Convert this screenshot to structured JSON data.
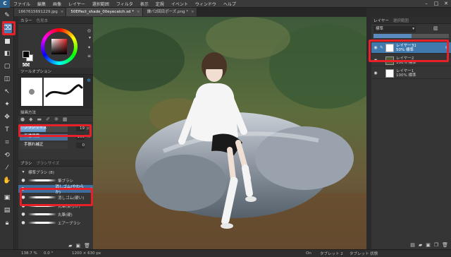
{
  "app": {
    "logo": "C"
  },
  "menu": {
    "items": [
      "ファイル",
      "編集",
      "画像",
      "レイヤー",
      "選択範囲",
      "フィルタ",
      "表示",
      "定規",
      "イベント",
      "ウィンドウ",
      "ヘルプ"
    ]
  },
  "window_controls": [
    "–",
    "□",
    "✕"
  ],
  "tabs": [
    {
      "label": "1667615691229.jpg",
      "active": false
    },
    {
      "label": "50Effect_shade_00eyecatch.sd *",
      "active": true
    },
    {
      "label": "鎌パ2回目ポーズ.png *",
      "active": false
    }
  ],
  "color_panel": {
    "tab_active": "カラー",
    "tab_other": "色見本",
    "fg_color": "#000000",
    "bg_color": "#ffffff"
  },
  "tool_option": {
    "title": "ツールオプション"
  },
  "drawing_method": {
    "title": "描画方法"
  },
  "brush_settings": {
    "size_label": "ブラシサイズ",
    "size_value": "19",
    "size_unit": "px",
    "size_fill": 0.55,
    "opacity_label": "不透明度",
    "opacity_value": "100",
    "opacity_unit": "%",
    "stabilizer_label": "手振れ補正",
    "stabilizer_value": "0"
  },
  "brush_panel": {
    "tab_active": "ブラシ",
    "tab_other": "ブラシサイズ",
    "group_label": "標準ブラシ (8)",
    "items": [
      {
        "label": "筆ブラシ",
        "selected": false
      },
      {
        "label": "消しゴム(やわらか)",
        "selected": true
      },
      {
        "label": "消しゴム(硬い)",
        "selected": false
      },
      {
        "label": "丸筆(柔らか)",
        "selected": false
      },
      {
        "label": "丸筆(硬)",
        "selected": false
      },
      {
        "label": "エアーブラシ",
        "selected": false
      }
    ]
  },
  "layer_panel": {
    "tab_active": "レイヤー",
    "tab_other": "選択範囲",
    "blend_mode": "標準",
    "opacity_value": "50",
    "layers": [
      {
        "name": "レイヤー31",
        "info": "50% 標準",
        "selected": true
      },
      {
        "name": "レイヤー2",
        "info": "100% 標準",
        "selected": false
      },
      {
        "name": "レイヤー1",
        "info": "100% 標準",
        "selected": false
      }
    ]
  },
  "status": {
    "zoom": "138.7 %",
    "angle": "0.0 °",
    "canvas_size": "1200 × 630 px",
    "state": "On",
    "tablet1": "タブレット 2",
    "tablet2": "タブレット 状態"
  }
}
